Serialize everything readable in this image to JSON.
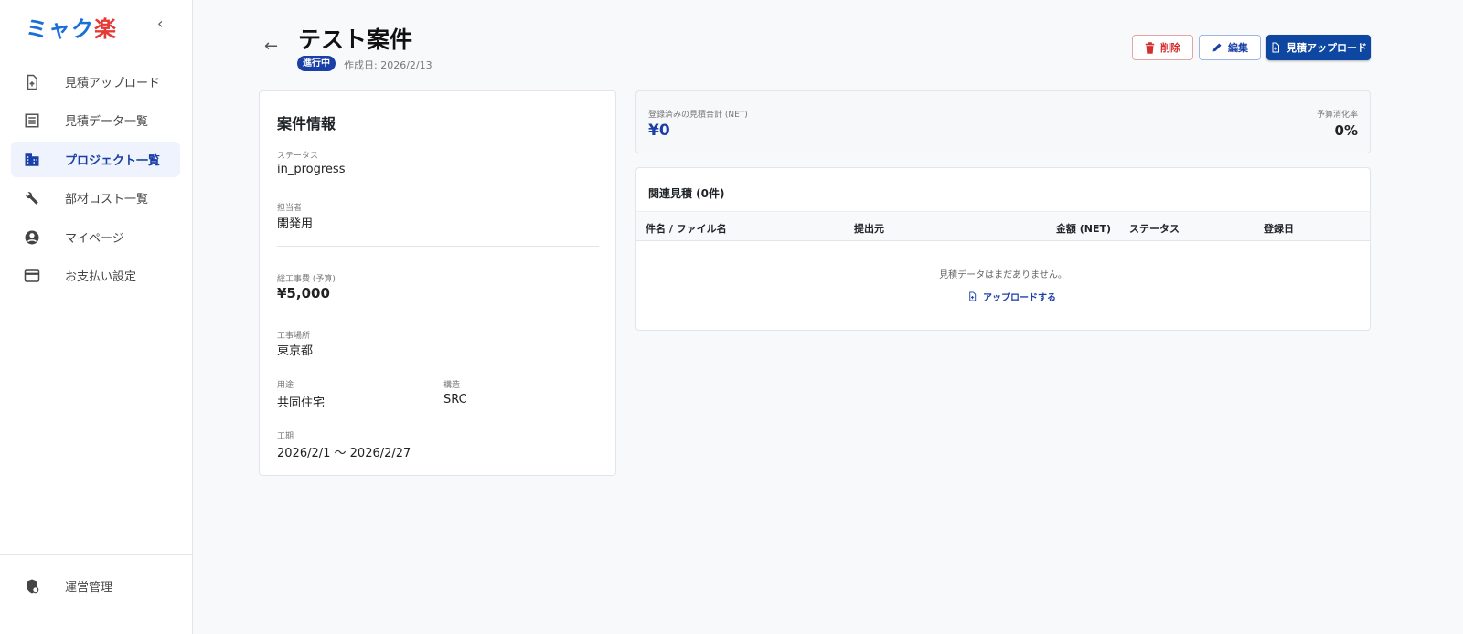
{
  "sidebar": {
    "logo_a": "ミャク",
    "logo_b": "楽",
    "items": [
      {
        "label": "見積アップロード"
      },
      {
        "label": "見積データ一覧"
      },
      {
        "label": "プロジェクト一覧"
      },
      {
        "label": "部材コスト一覧"
      },
      {
        "label": "マイページ"
      },
      {
        "label": "お支払い設定"
      }
    ],
    "admin": "運営管理"
  },
  "header": {
    "title": "テスト案件",
    "badge": "進行中",
    "created": "作成日: 2026/2/13",
    "delete": "削除",
    "edit": "編集",
    "upload": "見積アップロード"
  },
  "info": {
    "title": "案件情報",
    "status_label": "ステータス",
    "status": "in_progress",
    "owner_label": "担当者",
    "owner": "開発用",
    "budget_label": "総工事費 (予算)",
    "budget": "¥5,000",
    "location_label": "工事場所",
    "location": "東京都",
    "use_label": "用途",
    "use": "共同住宅",
    "structure_label": "構造",
    "structure": "SRC",
    "period_label": "工期",
    "period": "2026/2/1 〜 2026/2/27"
  },
  "summary": {
    "total_label": "登録済みの見積合計 (NET)",
    "total": "¥0",
    "rate_label": "予算消化率",
    "rate": "0%"
  },
  "related": {
    "title": "関連見積 (0件)",
    "columns": [
      "件名 / ファイル名",
      "提出元",
      "金額 (NET)",
      "ステータス",
      "登録日"
    ],
    "empty": "見積データはまだありません。",
    "upload_link": "アップロードする"
  },
  "colors": {
    "primary": "#0d47a1",
    "danger": "#d32f2f",
    "logo_blue": "#1a6fd8",
    "logo_red": "#e53935"
  }
}
